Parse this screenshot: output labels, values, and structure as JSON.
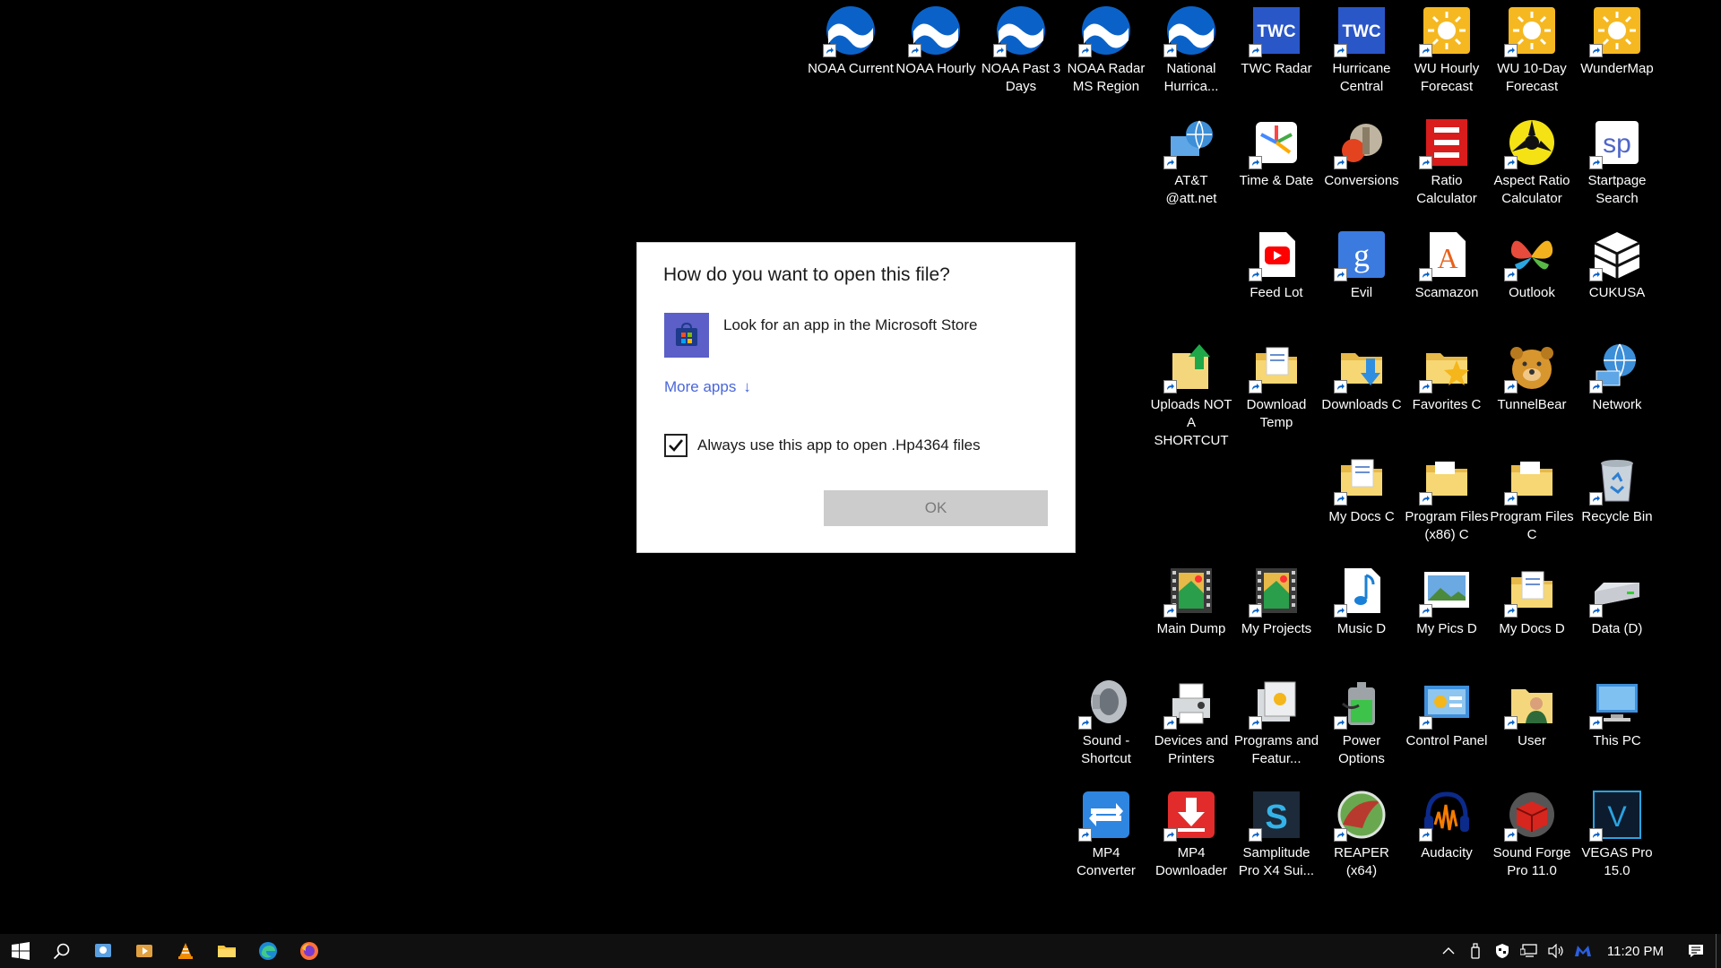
{
  "desktop": {
    "icons": [
      {
        "label": "NOAA Current",
        "icon": "noaa-icon"
      },
      {
        "label": "NOAA Hourly",
        "icon": "noaa-icon"
      },
      {
        "label": "NOAA Past 3 Days",
        "icon": "noaa-icon"
      },
      {
        "label": "NOAA Radar MS Region",
        "icon": "noaa-icon"
      },
      {
        "label": "National Hurrica...",
        "icon": "noaa-icon"
      },
      {
        "label": "TWC Radar",
        "icon": "twc-icon",
        "badge": "TWC"
      },
      {
        "label": "Hurricane Central",
        "icon": "twc-icon",
        "badge": "TWC"
      },
      {
        "label": "WU Hourly Forecast",
        "icon": "sun-icon"
      },
      {
        "label": "WU 10-Day Forecast",
        "icon": "sun-icon"
      },
      {
        "label": "WunderMap",
        "icon": "sun-icon"
      },
      {
        "label": "AT&T @att.net",
        "icon": "globe-computer-icon"
      },
      {
        "label": "Time & Date",
        "icon": "time-date-icon"
      },
      {
        "label": "Conversions",
        "icon": "conversions-icon"
      },
      {
        "label": "Ratio Calculator",
        "icon": "ratio-icon"
      },
      {
        "label": "Aspect Ratio Calculator",
        "icon": "record-adapter-icon"
      },
      {
        "label": "Startpage Search",
        "icon": "startpage-icon",
        "badge": "sp"
      },
      {
        "label": "Feed Lot",
        "icon": "youtube-icon"
      },
      {
        "label": "Evil",
        "icon": "google-icon",
        "badge": "g"
      },
      {
        "label": "Scamazon",
        "icon": "amazon-doc-icon",
        "badge": "A"
      },
      {
        "label": "Outlook",
        "icon": "butterfly-icon"
      },
      {
        "label": "CUKUSA",
        "icon": "cube-icon"
      },
      {
        "label": "Uploads NOT A SHORTCUT",
        "icon": "upload-folder-icon"
      },
      {
        "label": "Download Temp",
        "icon": "folder-doc-icon"
      },
      {
        "label": "Downloads C",
        "icon": "downloads-folder-icon"
      },
      {
        "label": "Favorites C",
        "icon": "favorites-folder-icon"
      },
      {
        "label": "TunnelBear",
        "icon": "bear-icon"
      },
      {
        "label": "Network",
        "icon": "network-icon"
      },
      {
        "label": "My Docs C",
        "icon": "folder-doc-icon"
      },
      {
        "label": "Program Files (x86) C",
        "icon": "folder-icon"
      },
      {
        "label": "Program Files C",
        "icon": "folder-icon"
      },
      {
        "label": "Recycle Bin",
        "icon": "recycle-bin-icon"
      },
      {
        "label": "Main Dump",
        "icon": "video-folder-icon"
      },
      {
        "label": "My Projects",
        "icon": "video-folder-icon"
      },
      {
        "label": "Music D",
        "icon": "music-icon"
      },
      {
        "label": "My Pics D",
        "icon": "pictures-icon"
      },
      {
        "label": "My Docs D",
        "icon": "folder-doc-icon"
      },
      {
        "label": "Data (D)",
        "icon": "drive-icon"
      },
      {
        "label": "Sound - Shortcut",
        "icon": "speaker-icon"
      },
      {
        "label": "Devices and Printers",
        "icon": "printer-icon"
      },
      {
        "label": "Programs and Featur...",
        "icon": "programs-icon"
      },
      {
        "label": "Power Options",
        "icon": "battery-icon"
      },
      {
        "label": "Control Panel",
        "icon": "control-panel-icon"
      },
      {
        "label": "User",
        "icon": "user-folder-icon"
      },
      {
        "label": "This PC",
        "icon": "this-pc-icon"
      },
      {
        "label": "MP4 Converter",
        "icon": "converter-icon"
      },
      {
        "label": "MP4 Downloader",
        "icon": "downloader-icon"
      },
      {
        "label": "Samplitude Pro X4 Sui...",
        "icon": "samplitude-icon",
        "badge": "S"
      },
      {
        "label": "REAPER (x64)",
        "icon": "reaper-icon"
      },
      {
        "label": "Audacity",
        "icon": "audacity-icon"
      },
      {
        "label": "Sound Forge Pro 11.0",
        "icon": "soundforge-icon"
      },
      {
        "label": "VEGAS Pro 15.0",
        "icon": "vegas-icon",
        "badge": "V"
      }
    ]
  },
  "dialog": {
    "title": "How do you want to open this file?",
    "store_option": "Look for an app in the Microsoft Store",
    "more_apps": "More apps",
    "more_apps_arrow": "↓",
    "always_use": "Always use this app to open .Hp4364 files",
    "always_use_checked": true,
    "ok_label": "OK"
  },
  "taskbar": {
    "pinned": [
      "start-icon",
      "search-icon",
      "task-app-icon",
      "media-player-icon",
      "vlc-icon",
      "file-explorer-icon",
      "edge-icon",
      "firefox-icon"
    ],
    "clock": "11:20 PM"
  }
}
